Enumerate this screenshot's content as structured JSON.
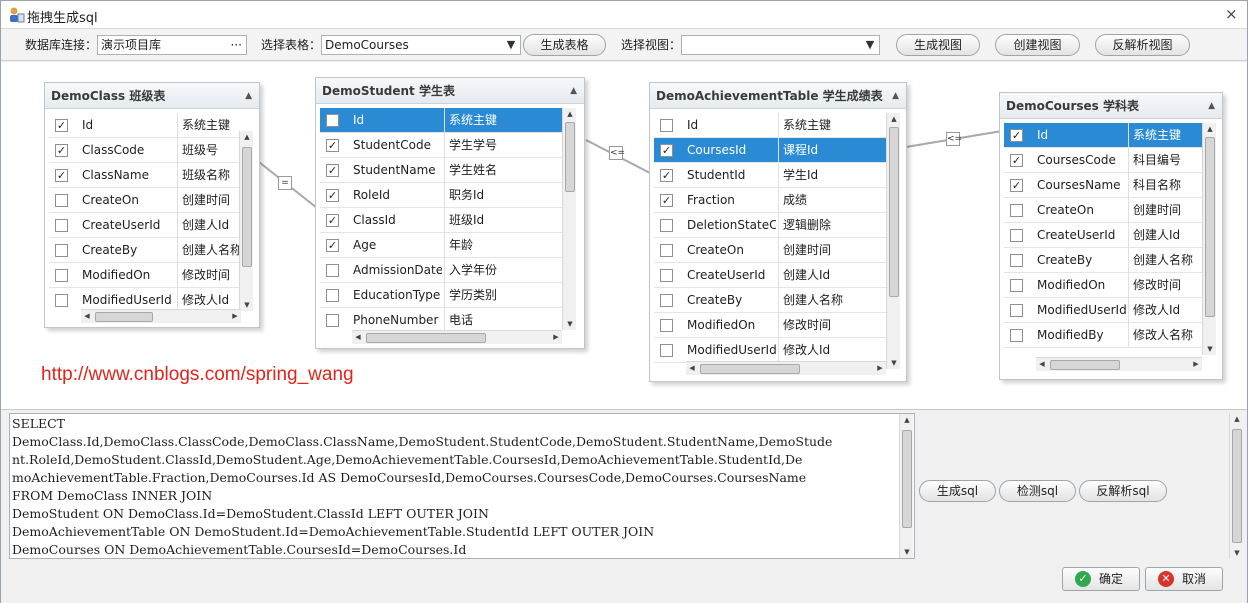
{
  "window": {
    "title": "拖拽生成sql",
    "close_glyph": "×"
  },
  "toolbar": {
    "db_label": "数据库连接：",
    "db_value": "演示项目库",
    "db_browse": "···",
    "table_label": "选择表格：",
    "table_value": "DemoCourses",
    "gen_table": "生成表格",
    "view_label": "选择视图：",
    "view_value": "",
    "gen_view": "生成视图",
    "create_view": "创建视图",
    "parse_view": "反解析视图"
  },
  "tables": [
    {
      "title": "DemoClass 班级表",
      "rows": [
        {
          "checked": true,
          "name": "Id",
          "desc": "系统主键"
        },
        {
          "checked": true,
          "name": "ClassCode",
          "desc": "班级号"
        },
        {
          "checked": true,
          "name": "ClassName",
          "desc": "班级名称"
        },
        {
          "checked": false,
          "name": "CreateOn",
          "desc": "创建时间"
        },
        {
          "checked": false,
          "name": "CreateUserId",
          "desc": "创建人Id"
        },
        {
          "checked": false,
          "name": "CreateBy",
          "desc": "创建人名称"
        },
        {
          "checked": false,
          "name": "ModifiedOn",
          "desc": "修改时间"
        },
        {
          "checked": false,
          "name": "ModifiedUserId",
          "desc": "修改人Id"
        }
      ]
    },
    {
      "title": "DemoStudent 学生表",
      "rows": [
        {
          "checked": false,
          "name": "Id",
          "desc": "系统主键",
          "selected": true
        },
        {
          "checked": true,
          "name": "StudentCode",
          "desc": "学生学号"
        },
        {
          "checked": true,
          "name": "StudentName",
          "desc": "学生姓名"
        },
        {
          "checked": true,
          "name": "RoleId",
          "desc": "职务Id"
        },
        {
          "checked": true,
          "name": "ClassId",
          "desc": "班级Id"
        },
        {
          "checked": true,
          "name": "Age",
          "desc": "年龄"
        },
        {
          "checked": false,
          "name": "AdmissionDate",
          "desc": "入学年份"
        },
        {
          "checked": false,
          "name": "EducationType",
          "desc": "学历类别"
        },
        {
          "checked": false,
          "name": "PhoneNumber",
          "desc": "电话"
        }
      ]
    },
    {
      "title": "DemoAchievementTable 学生成绩表",
      "rows": [
        {
          "checked": false,
          "name": "Id",
          "desc": "系统主键"
        },
        {
          "checked": true,
          "name": "CoursesId",
          "desc": "课程Id",
          "selected": true
        },
        {
          "checked": true,
          "name": "StudentId",
          "desc": "学生Id"
        },
        {
          "checked": true,
          "name": "Fraction",
          "desc": "成绩"
        },
        {
          "checked": false,
          "name": "DeletionStateCode",
          "desc": "逻辑删除"
        },
        {
          "checked": false,
          "name": "CreateOn",
          "desc": "创建时间"
        },
        {
          "checked": false,
          "name": "CreateUserId",
          "desc": "创建人Id"
        },
        {
          "checked": false,
          "name": "CreateBy",
          "desc": "创建人名称"
        },
        {
          "checked": false,
          "name": "ModifiedOn",
          "desc": "修改时间"
        },
        {
          "checked": false,
          "name": "ModifiedUserId",
          "desc": "修改人Id"
        }
      ]
    },
    {
      "title": "DemoCourses 学科表",
      "rows": [
        {
          "checked": true,
          "name": "Id",
          "desc": "系统主键",
          "selected": true
        },
        {
          "checked": true,
          "name": "CoursesCode",
          "desc": "科目编号"
        },
        {
          "checked": true,
          "name": "CoursesName",
          "desc": "科目名称"
        },
        {
          "checked": false,
          "name": "CreateOn",
          "desc": "创建时间"
        },
        {
          "checked": false,
          "name": "CreateUserId",
          "desc": "创建人Id"
        },
        {
          "checked": false,
          "name": "CreateBy",
          "desc": "创建人名称"
        },
        {
          "checked": false,
          "name": "ModifiedOn",
          "desc": "修改时间"
        },
        {
          "checked": false,
          "name": "ModifiedUserId",
          "desc": "修改人Id"
        },
        {
          "checked": false,
          "name": "ModifiedBy",
          "desc": "修改人名称"
        }
      ]
    }
  ],
  "relations": {
    "r1": "=",
    "r2": "<=",
    "r3": "<="
  },
  "watermark": "http://www.cnblogs.com/spring_wang",
  "sql": {
    "lines": [
      "SELECT",
      "DemoClass.Id,DemoClass.ClassCode,DemoClass.ClassName,DemoStudent.StudentCode,DemoStudent.StudentName,DemoStude",
      "nt.RoleId,DemoStudent.ClassId,DemoStudent.Age,DemoAchievementTable.CoursesId,DemoAchievementTable.StudentId,De",
      "moAchievementTable.Fraction,DemoCourses.Id AS DemoCoursesId,DemoCourses.CoursesCode,DemoCourses.CoursesName",
      "FROM DemoClass INNER JOIN",
      "DemoStudent ON DemoClass.Id=DemoStudent.ClassId LEFT OUTER JOIN",
      "DemoAchievementTable ON DemoStudent.Id=DemoAchievementTable.StudentId LEFT OUTER JOIN",
      "DemoCourses ON DemoAchievementTable.CoursesId=DemoCourses.Id"
    ]
  },
  "sql_actions": {
    "gen": "生成sql",
    "check": "检测sql",
    "parse": "反解析sql"
  },
  "footer": {
    "ok": "确定",
    "cancel": "取消"
  },
  "colors": {
    "selected_row": "#2a8ad4",
    "watermark": "#e1251b",
    "ok_icon": "#2fa84f",
    "cancel_icon": "#d9332b"
  }
}
